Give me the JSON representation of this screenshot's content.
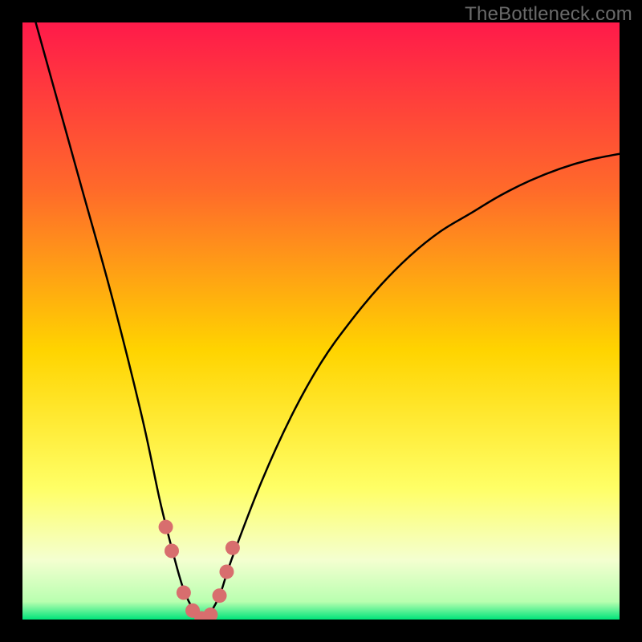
{
  "watermark": {
    "text": "TheBottleneck.com"
  },
  "colors": {
    "black": "#000000",
    "curve": "#000000",
    "marker": "#d86e6e",
    "grad_top": "#ff1a4a",
    "grad_mid1": "#ff7a2a",
    "grad_mid2": "#ffd400",
    "grad_mid3": "#ffff66",
    "grad_mid4": "#f6ffb0",
    "grad_bottom": "#00e47a"
  },
  "chart_data": {
    "type": "line",
    "title": "",
    "xlabel": "",
    "ylabel": "",
    "xlim": [
      0,
      100
    ],
    "ylim": [
      0,
      100
    ],
    "series": [
      {
        "name": "bottleneck-curve",
        "x": [
          0,
          5,
          10,
          15,
          20,
          23,
          25,
          27,
          29,
          30,
          31,
          33,
          35,
          40,
          45,
          50,
          55,
          60,
          65,
          70,
          75,
          80,
          85,
          90,
          95,
          100
        ],
        "values": [
          108,
          90,
          72,
          54,
          34,
          20,
          12,
          5,
          1,
          0,
          0.5,
          4,
          10,
          23,
          34,
          43,
          50,
          56,
          61,
          65,
          68,
          71,
          73.5,
          75.5,
          77,
          78
        ]
      }
    ],
    "markers": {
      "name": "curve-markers",
      "x": [
        24.0,
        25.0,
        27.0,
        28.5,
        30.0,
        31.5,
        33.0,
        34.2,
        35.2
      ],
      "values": [
        15.5,
        11.5,
        4.5,
        1.5,
        0.2,
        0.8,
        4.0,
        8.0,
        12.0
      ]
    }
  }
}
